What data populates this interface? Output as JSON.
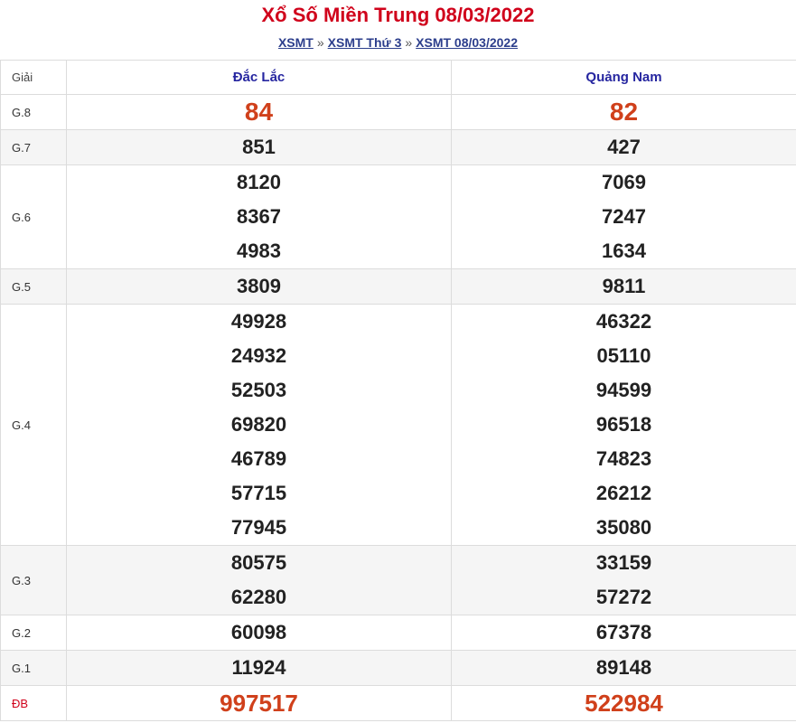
{
  "header": {
    "title": "Xổ Số Miền Trung 08/03/2022",
    "breadcrumb": [
      "XSMT",
      "XSMT Thứ 3",
      "XSMT 08/03/2022"
    ],
    "separator": "»"
  },
  "table": {
    "label_header": "Giải",
    "provinces": [
      "Đắc Lắc",
      "Quảng Nam"
    ],
    "rows": [
      {
        "label": "G.8",
        "p1": [
          "84"
        ],
        "p2": [
          "82"
        ]
      },
      {
        "label": "G.7",
        "p1": [
          "851"
        ],
        "p2": [
          "427"
        ]
      },
      {
        "label": "G.6",
        "p1": [
          "8120",
          "8367",
          "4983"
        ],
        "p2": [
          "7069",
          "7247",
          "1634"
        ]
      },
      {
        "label": "G.5",
        "p1": [
          "3809"
        ],
        "p2": [
          "9811"
        ]
      },
      {
        "label": "G.4",
        "p1": [
          "49928",
          "24932",
          "52503",
          "69820",
          "46789",
          "57715",
          "77945"
        ],
        "p2": [
          "46322",
          "05110",
          "94599",
          "96518",
          "74823",
          "26212",
          "35080"
        ]
      },
      {
        "label": "G.3",
        "p1": [
          "80575",
          "62280"
        ],
        "p2": [
          "33159",
          "57272"
        ]
      },
      {
        "label": "G.2",
        "p1": [
          "60098"
        ],
        "p2": [
          "67378"
        ]
      },
      {
        "label": "G.1",
        "p1": [
          "11924"
        ],
        "p2": [
          "89148"
        ]
      },
      {
        "label": "ĐB",
        "p1": [
          "997517"
        ],
        "p2": [
          "522984"
        ]
      }
    ]
  },
  "colors": {
    "title": "#d0021b",
    "highlight": "#d0401b",
    "province": "#2626a0",
    "link": "#2c3e8c"
  }
}
